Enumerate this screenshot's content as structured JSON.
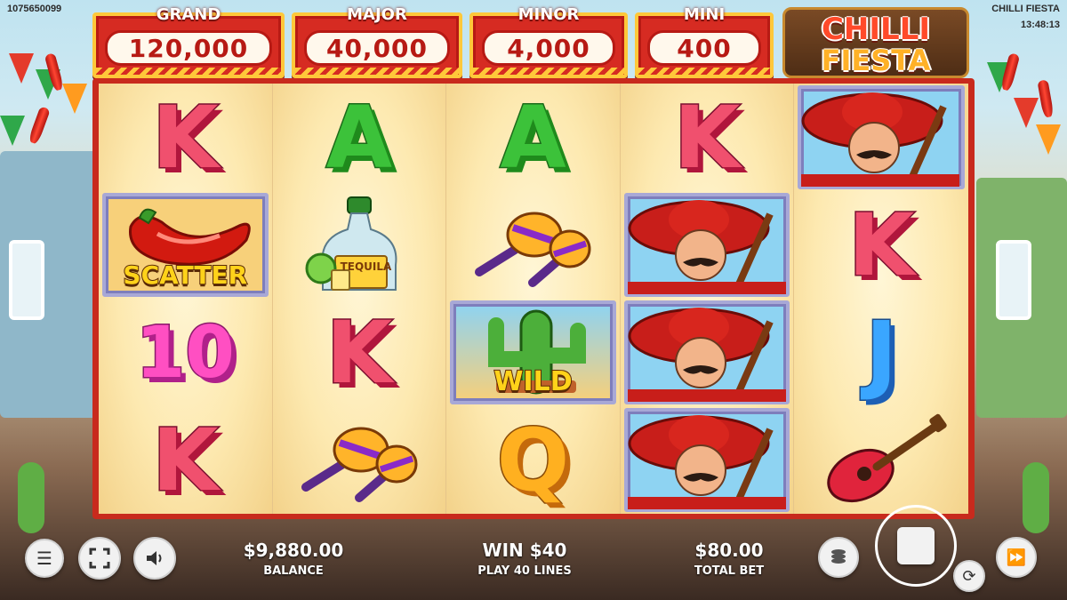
{
  "system": {
    "session_id": "1075650099",
    "game_name": "CHILLI FIESTA",
    "clock": "13:48:13"
  },
  "jackpots": [
    {
      "label": "GRAND",
      "value": "120,000"
    },
    {
      "label": "MAJOR",
      "value": "40,000"
    },
    {
      "label": "MINOR",
      "value": "4,000"
    },
    {
      "label": "MINI",
      "value": "400"
    }
  ],
  "logo": {
    "line1": "CHILLI",
    "line2": "FIESTA"
  },
  "reels": [
    [
      "K",
      "SCATTER",
      "10",
      "K"
    ],
    [
      "A",
      "TEQUILA",
      "K",
      "MARACAS"
    ],
    [
      "A",
      "MARACAS",
      "WILD",
      "Q"
    ],
    [
      "K",
      "MARIACHI",
      "MARIACHI",
      "MARIACHI"
    ],
    [
      "MARIACHI",
      "K",
      "J",
      "GUITAR"
    ]
  ],
  "symbol_labels": {
    "scatter": "SCATTER",
    "wild": "WILD",
    "tequila": "TEQUILA"
  },
  "footer": {
    "balance_value": "$9,880.00",
    "balance_label": "BALANCE",
    "win_value": "WIN $40",
    "lines_label": "PLAY 40 LINES",
    "bet_value": "$80.00",
    "bet_label": "TOTAL BET"
  },
  "colors": {
    "frame_red": "#c82a1d",
    "jackpot_gold": "#ffc83a",
    "reel_bg": "#fde9b0"
  }
}
